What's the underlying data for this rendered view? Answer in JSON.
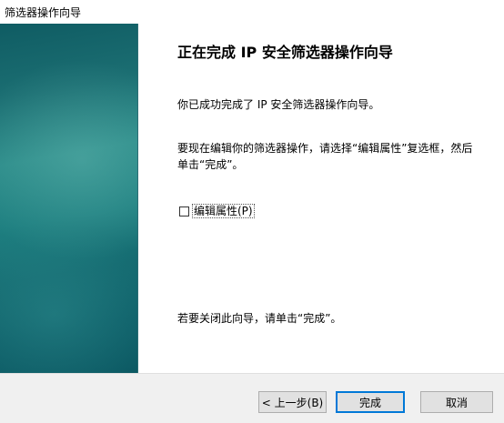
{
  "window": {
    "title": "筛选器操作向导"
  },
  "wizard": {
    "heading": "正在完成 IP 安全筛选器操作向导",
    "para1": "你已成功完成了 IP 安全筛选器操作向导。",
    "para2": "要现在编辑你的筛选器操作，请选择“编辑属性”复选框，然后单击“完成”。",
    "checkbox_label": "编辑属性(P)",
    "checkbox_checked": false,
    "para3": "若要关闭此向导，请单击“完成”。"
  },
  "buttons": {
    "back": "< 上一步(B)",
    "finish": "完成",
    "cancel": "取消"
  },
  "colors": {
    "sidebar_gradient_start": "#0f5c63",
    "sidebar_gradient_mid": "#2a8a88",
    "focus_border": "#0078d7"
  }
}
